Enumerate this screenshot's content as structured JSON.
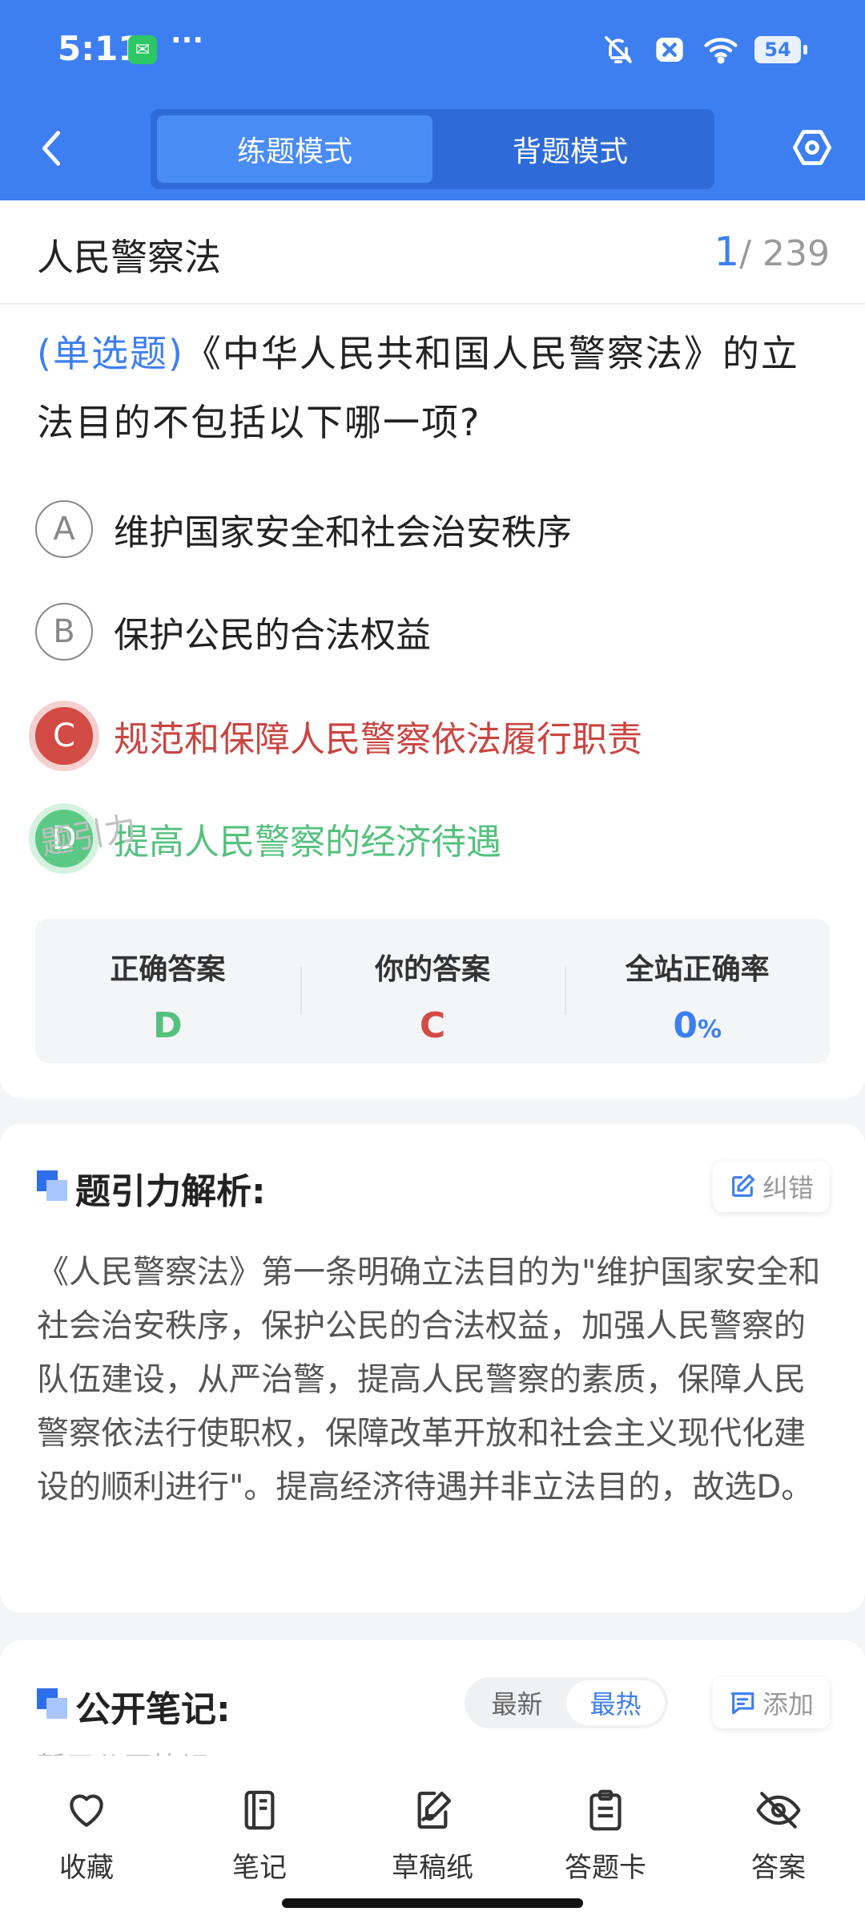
{
  "status_bar": {
    "time": "5:11",
    "battery": "54",
    "icons": [
      "wechat-icon",
      "more-icon",
      "mute-icon",
      "close-icon",
      "wifi-icon",
      "battery-icon"
    ]
  },
  "nav": {
    "modes": [
      {
        "label": "练题模式",
        "active": true
      },
      {
        "label": "背题模式",
        "active": false
      }
    ]
  },
  "header": {
    "subject": "人民警察法",
    "current": "1",
    "total": "/ 239"
  },
  "question": {
    "type": "(单选题)",
    "text": "《中华人民共和国人民警察法》的立法目的不包括以下哪一项?",
    "options": [
      {
        "letter": "A",
        "text": "维护国家安全和社会治安秩序",
        "state": "normal"
      },
      {
        "letter": "B",
        "text": "保护公民的合法权益",
        "state": "normal"
      },
      {
        "letter": "C",
        "text": "规范和保障人民警察依法履行职责",
        "state": "wrong"
      },
      {
        "letter": "D",
        "text": "提高人民警察的经济待遇",
        "state": "right"
      }
    ]
  },
  "answers": {
    "correct_label": "正确答案",
    "correct_value": "D",
    "yours_label": "你的答案",
    "yours_value": "C",
    "rate_label": "全站正确率",
    "rate_value": "0",
    "rate_unit": "%",
    "watermark": "题引力"
  },
  "analysis": {
    "title": "题引力解析:",
    "correct_btn": "纠错",
    "text": "《人民警察法》第一条明确立法目的为\"维护国家安全和社会治安秩序，保护公民的合法权益，加强人民警察的队伍建设，从严治警，提高人民警察的素质，保障人民警察依法行使职权，保障改革开放和社会主义现代化建设的顺利进行\"。提高经济待遇并非立法目的，故选D。"
  },
  "notes": {
    "title": "公开笔记:",
    "sort_latest": "最新",
    "sort_hot": "最热",
    "add_btn": "添加",
    "empty": "暂无公开笔记"
  },
  "bottom_bar": [
    {
      "label": "收藏",
      "icon": "heart-icon"
    },
    {
      "label": "笔记",
      "icon": "notebook-icon"
    },
    {
      "label": "草稿纸",
      "icon": "draft-icon"
    },
    {
      "label": "答题卡",
      "icon": "answer-card-icon"
    },
    {
      "label": "答案",
      "icon": "eye-off-icon"
    }
  ],
  "colors": {
    "primary": "#3d7ff0",
    "wrong": "#d24b45",
    "right": "#5cc885"
  }
}
